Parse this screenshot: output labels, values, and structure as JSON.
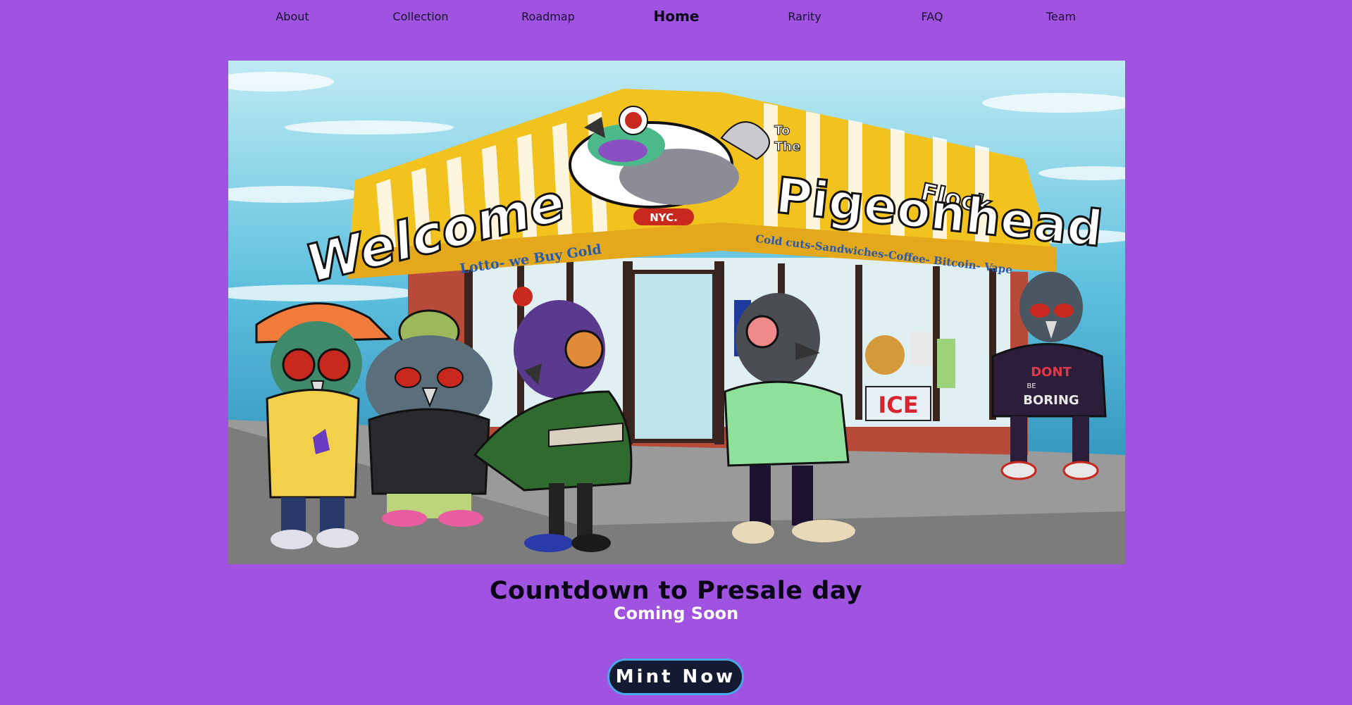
{
  "nav": {
    "items": [
      {
        "label": "About",
        "active": false
      },
      {
        "label": "Collection",
        "active": false
      },
      {
        "label": "Roadmap",
        "active": false
      },
      {
        "label": "Home",
        "active": true
      },
      {
        "label": "Rarity",
        "active": false
      },
      {
        "label": "FAQ",
        "active": false
      },
      {
        "label": "Team",
        "active": false
      }
    ]
  },
  "hero": {
    "sign_welcome": "Welcome",
    "sign_to": "To",
    "sign_the": "The",
    "sign_pigeonhead": "Pigeonhead",
    "sign_flock": "Flock",
    "sign_nyc": "NYC.",
    "awning_left": "Lotto- we Buy Gold",
    "awning_right": "Cold cuts-Sandwiches-Coffee- Bitcoin- Vape",
    "window_ice": "ICE",
    "hoodie_text_1": "DONT",
    "hoodie_text_2": "BE",
    "hoodie_text_3": "BORING"
  },
  "countdown": {
    "title": "Countdown to Presale day",
    "status": "Coming Soon"
  },
  "cta": {
    "mint_label": "Mint Now"
  },
  "colors": {
    "background": "#a052e0",
    "button_bg": "#151a33",
    "button_border": "#4aa8e8",
    "awning_yellow": "#f2c21f"
  }
}
